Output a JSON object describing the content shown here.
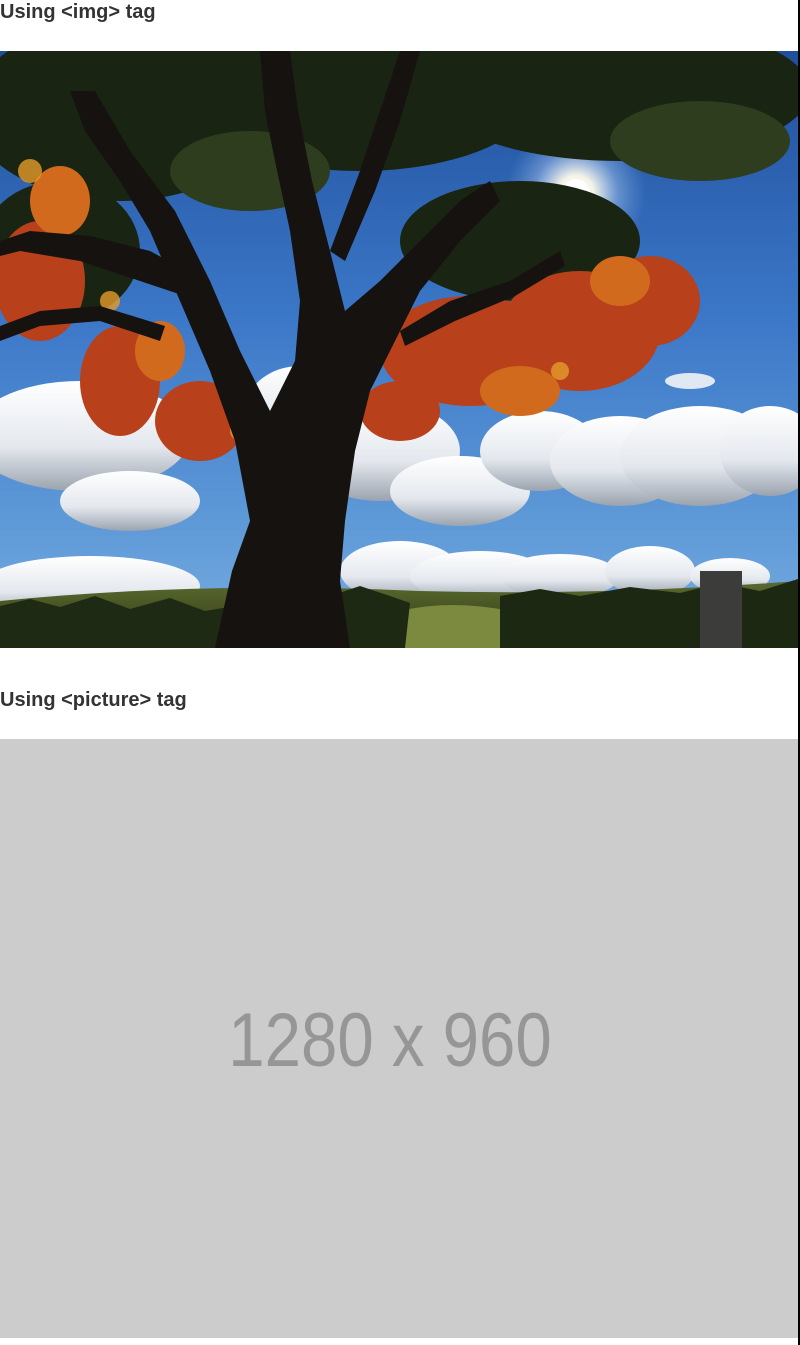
{
  "sections": {
    "img": {
      "heading": "Using <img> tag"
    },
    "picture": {
      "heading": "Using <picture> tag",
      "placeholder_text": "1280 x 960",
      "placeholder_bg": "#cccccc",
      "placeholder_fg": "#969696"
    }
  },
  "colors": {
    "heading_text": "#333333",
    "page_bg": "#ffffff"
  }
}
